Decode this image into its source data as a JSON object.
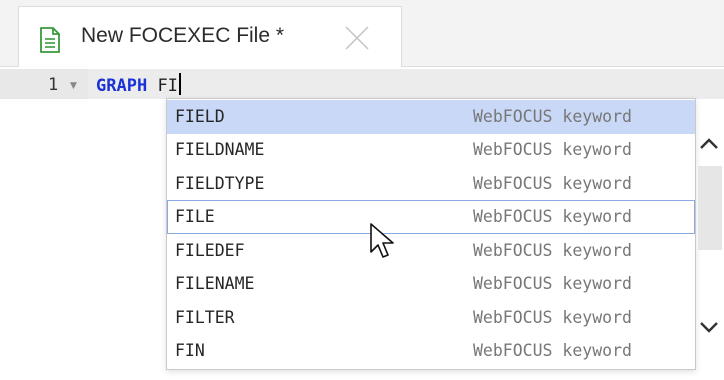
{
  "tab": {
    "title": "New FOCEXEC File *",
    "icon": "document-icon",
    "close_icon": "close-icon"
  },
  "editor": {
    "line_number": "1",
    "keyword": "GRAPH",
    "typed_text": "FI"
  },
  "autocomplete": {
    "items": [
      {
        "name": "FIELD",
        "type": "WebFOCUS keyword"
      },
      {
        "name": "FIELDNAME",
        "type": "WebFOCUS keyword"
      },
      {
        "name": "FIELDTYPE",
        "type": "WebFOCUS keyword"
      },
      {
        "name": "FILE",
        "type": "WebFOCUS keyword"
      },
      {
        "name": "FILEDEF",
        "type": "WebFOCUS keyword"
      },
      {
        "name": "FILENAME",
        "type": "WebFOCUS keyword"
      },
      {
        "name": "FILTER",
        "type": "WebFOCUS keyword"
      },
      {
        "name": "FIN",
        "type": "WebFOCUS keyword"
      }
    ],
    "selected_index": 0,
    "hovered_index": 3
  },
  "colors": {
    "keyword": "#1a33d6",
    "selected_row": "#c8d8f6",
    "hover_border": "#8aaae4",
    "doc_icon": "#3a9a3a"
  }
}
